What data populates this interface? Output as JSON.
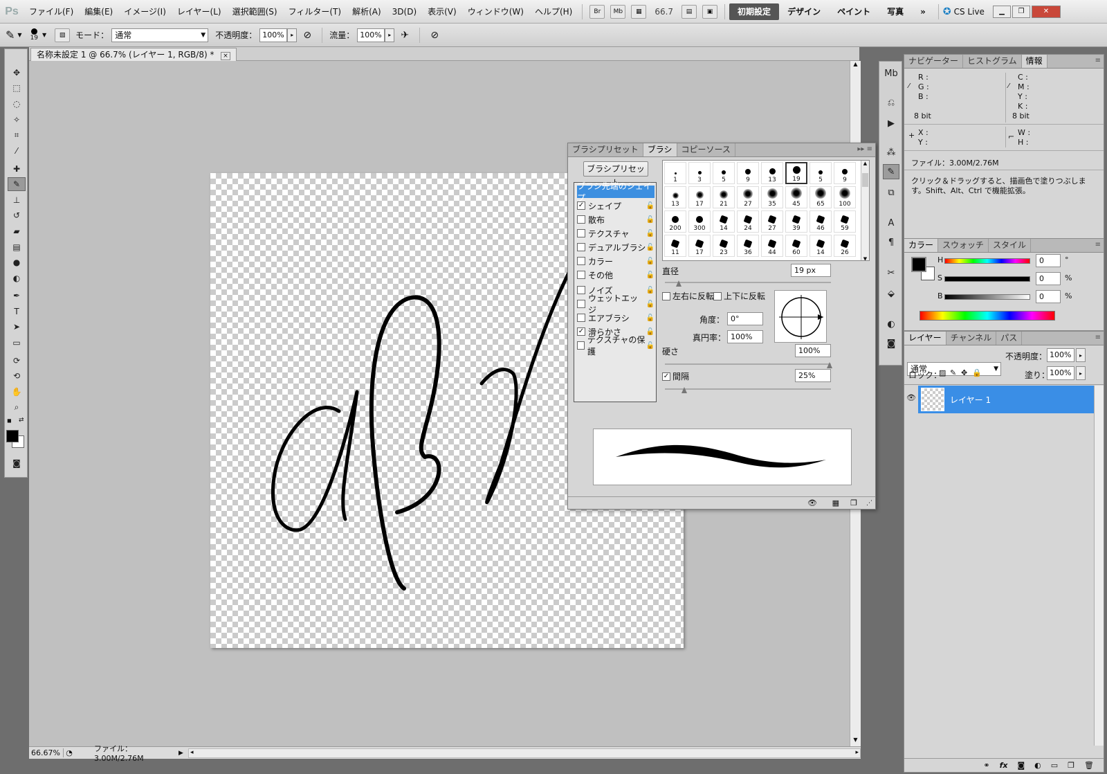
{
  "app": {
    "logo": "Ps",
    "menu": [
      "ファイル(F)",
      "編集(E)",
      "イメージ(I)",
      "レイヤー(L)",
      "選択範囲(S)",
      "フィルター(T)",
      "解析(A)",
      "3D(D)",
      "表示(V)",
      "ウィンドウ(W)",
      "ヘルプ(H)"
    ],
    "appbar_icons": [
      "Br",
      "Mb"
    ],
    "zoom": "66.7",
    "workspaces": [
      {
        "label": "初期設定",
        "active": true
      },
      {
        "label": "デザイン",
        "active": false
      },
      {
        "label": "ペイント",
        "active": false
      },
      {
        "label": "写真",
        "active": false
      }
    ],
    "more": "»",
    "cs_live": "CS Live"
  },
  "options_bar": {
    "brush_size": "19",
    "mode_label": "モード：",
    "mode_value": "通常",
    "opacity_label": "不透明度：",
    "opacity_value": "100%",
    "flow_label": "流量：",
    "flow_value": "100%"
  },
  "document": {
    "tab_title": "名称未設定 1 @ 66.7% (レイヤー 1, RGB/8) *",
    "tab_close": "×",
    "status_zoom": "66.67%",
    "status_file": "ファイル：3.00M/2.76M",
    "drawing_description_chars": "αβγ"
  },
  "brush_panel": {
    "tabs": [
      {
        "label": "ブラシプリセット",
        "active": false
      },
      {
        "label": "ブラシ",
        "active": true
      },
      {
        "label": "コピーソース",
        "active": false
      }
    ],
    "preset_button": "ブラシプリセット",
    "options": [
      {
        "label": "ブラシ先端のシェイプ",
        "header": true,
        "checked": false,
        "lock": false
      },
      {
        "label": "シェイプ",
        "checked": true,
        "lock": true
      },
      {
        "label": "散布",
        "checked": false,
        "lock": true
      },
      {
        "label": "テクスチャ",
        "checked": false,
        "lock": true
      },
      {
        "label": "デュアルブラシ",
        "checked": false,
        "lock": true
      },
      {
        "label": "カラー",
        "checked": false,
        "lock": true
      },
      {
        "label": "その他",
        "checked": false,
        "lock": true
      },
      {
        "label": "ノイズ",
        "checked": false,
        "lock": true
      },
      {
        "label": "ウェットエッジ",
        "checked": false,
        "lock": true
      },
      {
        "label": "エアブラシ",
        "checked": false,
        "lock": true
      },
      {
        "label": "滑らかさ",
        "checked": true,
        "lock": true
      },
      {
        "label": "テクスチャの保護",
        "checked": false,
        "lock": true
      }
    ],
    "presets": [
      [
        "1",
        "3",
        "5",
        "9",
        "13",
        "19",
        "5",
        "9"
      ],
      [
        "13",
        "17",
        "21",
        "27",
        "35",
        "45",
        "65",
        "100"
      ],
      [
        "200",
        "300",
        "14",
        "24",
        "27",
        "39",
        "46",
        "59"
      ],
      [
        "11",
        "17",
        "23",
        "36",
        "44",
        "60",
        "14",
        "26"
      ]
    ],
    "selected_preset": "19",
    "diameter_label": "直径",
    "diameter_value": "19 px",
    "flip_x_label": "左右に反転",
    "flip_y_label": "上下に反転",
    "angle_label": "角度：",
    "angle_value": "0°",
    "roundness_label": "真円率：",
    "roundness_value": "100%",
    "hardness_label": "硬さ",
    "hardness_value": "100%",
    "spacing_label": "間隔",
    "spacing_checked": true,
    "spacing_value": "25%"
  },
  "info_panel": {
    "tabs": [
      {
        "label": "ナビゲーター",
        "active": false
      },
      {
        "label": "ヒストグラム",
        "active": false
      },
      {
        "label": "情報",
        "active": true
      }
    ],
    "r": "R :",
    "g": "G :",
    "b": "B :",
    "c": "C :",
    "m": "M :",
    "y": "Y :",
    "k": "K :",
    "bit_left": "8 bit",
    "bit_right": "8 bit",
    "x": "X :",
    "yy": "Y :",
    "w": "W :",
    "h": "H :",
    "file": "ファイル：3.00M/2.76M",
    "hint": "クリック＆ドラッグすると、描画色で塗りつぶします。Shift、Alt、Ctrl で機能拡張。"
  },
  "color_panel": {
    "tabs": [
      {
        "label": "カラー",
        "active": true
      },
      {
        "label": "スウォッチ",
        "active": false
      },
      {
        "label": "スタイル",
        "active": false
      }
    ],
    "h_label": "H",
    "h_value": "0",
    "h_unit": "°",
    "s_label": "S",
    "s_value": "0",
    "s_unit": "%",
    "b_label": "B",
    "b_value": "0",
    "b_unit": "%",
    "foreground": "#000000",
    "background": "#ffffff"
  },
  "layers_panel": {
    "tabs": [
      {
        "label": "レイヤー",
        "active": true
      },
      {
        "label": "チャンネル",
        "active": false
      },
      {
        "label": "パス",
        "active": false
      }
    ],
    "blend_mode": "通常",
    "opacity_label": "不透明度：",
    "opacity_value": "100%",
    "lock_label": "ロック：",
    "fill_label": "塗り：",
    "fill_value": "100%",
    "layers": [
      {
        "name": "レイヤー 1",
        "visible": true,
        "selected": true
      }
    ],
    "footer_icons": [
      "link-icon",
      "fx-icon",
      "mask-icon",
      "adjustment-icon",
      "group-icon",
      "new-layer-icon",
      "trash-icon"
    ]
  },
  "colors": {
    "accent": "#3a8ee6",
    "canvas_bg": "#c0c0c0",
    "chrome": "#d6d6d6"
  }
}
